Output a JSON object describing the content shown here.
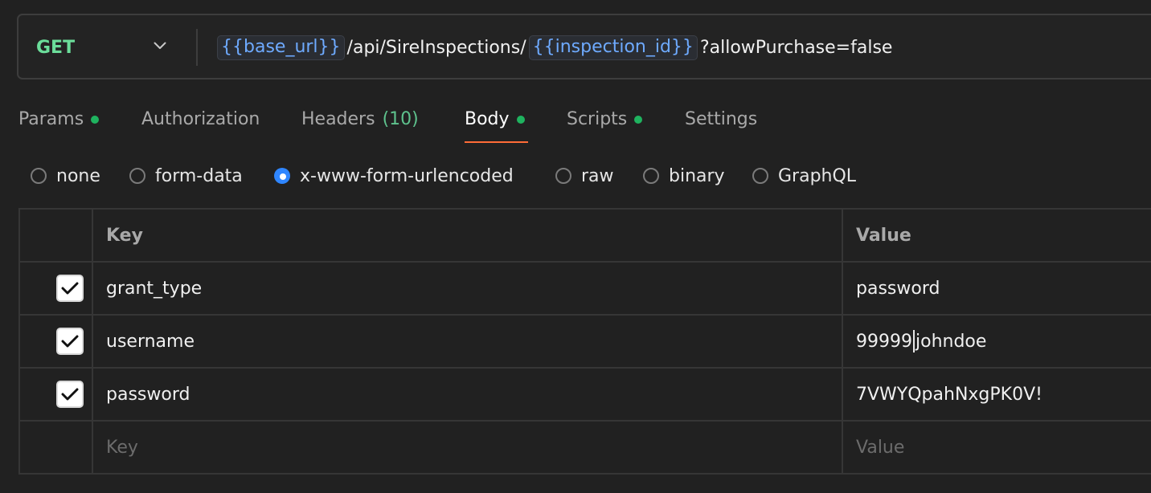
{
  "request": {
    "method": "GET",
    "url_parts": [
      {
        "type": "var",
        "text": "{{base_url}}"
      },
      {
        "type": "plain",
        "text": "/api/SireInspections/"
      },
      {
        "type": "var",
        "text": "{{inspection_id}}"
      },
      {
        "type": "plain",
        "text": "?allowPurchase=false"
      }
    ]
  },
  "tabs": [
    {
      "label": "Params",
      "dot": true
    },
    {
      "label": "Authorization"
    },
    {
      "label": "Headers",
      "count": "(10)"
    },
    {
      "label": "Body",
      "dot": true,
      "active": true
    },
    {
      "label": "Scripts",
      "dot": true
    },
    {
      "label": "Settings"
    }
  ],
  "body_types": [
    {
      "label": "none"
    },
    {
      "label": "form-data"
    },
    {
      "label": "x-www-form-urlencoded",
      "selected": true
    },
    {
      "label": "raw"
    },
    {
      "label": "binary"
    },
    {
      "label": "GraphQL"
    }
  ],
  "table": {
    "headers": {
      "key": "Key",
      "value": "Value"
    },
    "rows": [
      {
        "checked": true,
        "key": "grant_type",
        "value": "password"
      },
      {
        "checked": true,
        "key": "username",
        "value_before_caret": "99999",
        "value_after_caret": "johndoe"
      },
      {
        "checked": true,
        "key": "password",
        "value": "7VWYQpahNxgPK0V!"
      }
    ],
    "placeholder": {
      "key": "Key",
      "value": "Value"
    }
  },
  "colors": {
    "background": "#212121",
    "method": "#6bdd9a",
    "variable": "#6eaaff",
    "tab_active_underline": "#ff6c37",
    "status_dot": "#1fb35f",
    "radio_selected": "#2f86ff"
  }
}
